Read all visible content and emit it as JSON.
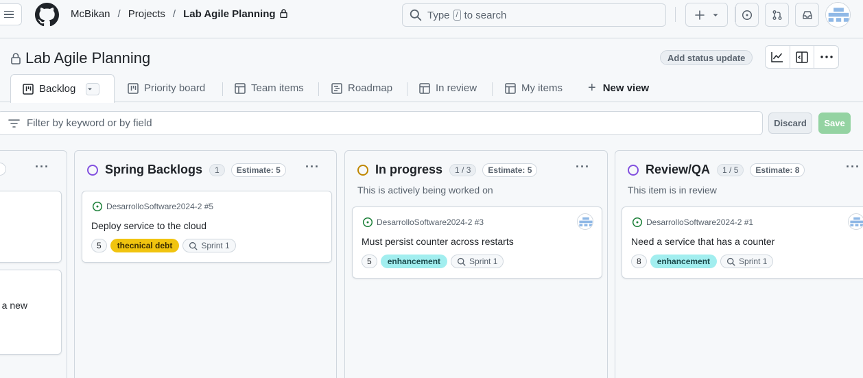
{
  "header": {
    "breadcrumb": {
      "owner": "McBikan",
      "sep1": "/",
      "projects": "Projects",
      "sep2": "/",
      "current": "Lab Agile Planning"
    },
    "search": {
      "prefix": "Type",
      "key": "/",
      "suffix": "to search"
    }
  },
  "project": {
    "title": "Lab Agile Planning",
    "status_update": "Add status update"
  },
  "tabs": [
    {
      "label": "Backlog",
      "active": true
    },
    {
      "label": "Priority board"
    },
    {
      "label": "Team items"
    },
    {
      "label": "Roadmap"
    },
    {
      "label": "In review"
    },
    {
      "label": "My items"
    }
  ],
  "new_view": {
    "plus": "+",
    "label": "New view"
  },
  "filter": {
    "placeholder": "Filter by keyword or by field",
    "discard": "Discard",
    "save": "Save"
  },
  "columns": [
    {
      "name": "Spring Backlogs",
      "count": "1",
      "estimate": "Estimate: 5",
      "color": "#8250df",
      "description": "",
      "cards": [
        {
          "ref": "DesarrolloSoftware2024-2 #5",
          "title": "Deploy service to the cloud",
          "points": "5",
          "label": "thecnical debt",
          "label_bg": "#f1c40f",
          "label_fg": "#3d2e00",
          "sprint": "Sprint 1",
          "has_avatar": false
        }
      ]
    },
    {
      "name": "In progress",
      "count": "1 / 3",
      "estimate": "Estimate: 5",
      "color": "#bf8700",
      "description": "This is actively being worked on",
      "cards": [
        {
          "ref": "DesarrolloSoftware2024-2 #3",
          "title": "Must persist counter across restarts",
          "points": "5",
          "label": "enhancement",
          "label_bg": "#a2eeef",
          "label_fg": "#1b4a4c",
          "sprint": "Sprint 1",
          "has_avatar": true
        }
      ]
    },
    {
      "name": "Review/QA",
      "count": "1 / 5",
      "estimate": "Estimate: 8",
      "color": "#8250df",
      "description": "This item is in review",
      "cards": [
        {
          "ref": "DesarrolloSoftware2024-2 #1",
          "title": "Need a service that has a counter",
          "points": "8",
          "label": "enhancement",
          "label_bg": "#a2eeef",
          "label_fg": "#1b4a4c",
          "sprint": "Sprint 1",
          "has_avatar": true
        }
      ]
    }
  ],
  "partial_column": {
    "card_fragment": "o a new"
  },
  "colors": {
    "open_issue": "#1a7f37",
    "accent_save": "#94d3a2",
    "border": "#d0d7de"
  },
  "icons": [
    "hamburger-icon",
    "github-logo-icon",
    "lock-icon",
    "search-icon",
    "plus-icon",
    "issues-icon",
    "pull-request-icon",
    "inbox-icon",
    "insights-icon",
    "side-panel-icon",
    "kebab-icon",
    "board-icon",
    "table-icon",
    "roadmap-icon",
    "filter-icon",
    "issue-open-icon",
    "iteration-icon"
  ]
}
